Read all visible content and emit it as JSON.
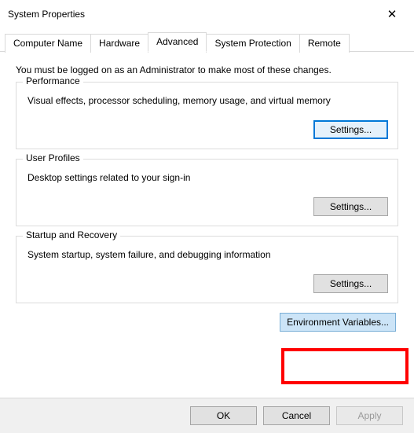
{
  "window": {
    "title": "System Properties",
    "close_glyph": "✕"
  },
  "tabs": {
    "computer_name": "Computer Name",
    "hardware": "Hardware",
    "advanced": "Advanced",
    "system_protection": "System Protection",
    "remote": "Remote"
  },
  "intro": "You must be logged on as an Administrator to make most of these changes.",
  "performance": {
    "legend": "Performance",
    "desc": "Visual effects, processor scheduling, memory usage, and virtual memory",
    "settings_btn": "Settings..."
  },
  "user_profiles": {
    "legend": "User Profiles",
    "desc": "Desktop settings related to your sign-in",
    "settings_btn": "Settings..."
  },
  "startup": {
    "legend": "Startup and Recovery",
    "desc": "System startup, system failure, and debugging information",
    "settings_btn": "Settings..."
  },
  "env_vars_btn": "Environment Variables...",
  "footer": {
    "ok": "OK",
    "cancel": "Cancel",
    "apply": "Apply"
  }
}
